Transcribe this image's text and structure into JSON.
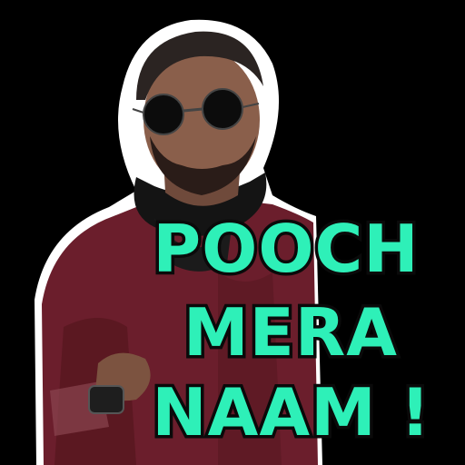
{
  "sticker": {
    "caption_lines": [
      "POOCH",
      "MERA",
      "NAAM !"
    ],
    "caption_color": "#2EF0B8",
    "outline_color": "#0a0a0a",
    "background_color": "#000000"
  }
}
